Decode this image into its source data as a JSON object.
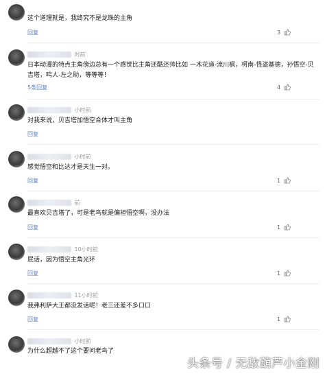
{
  "comments": [
    {
      "time": "",
      "text": "这个道理就是，我终究不是龙珠的主角",
      "reply_label": "回复",
      "replies_label": "",
      "likes": "3"
    },
    {
      "time": "时前",
      "text": "日本动漫的特点主角傍边总有一个感觉比主角还酷还帅比如 一木花道-流川枫，柯南-怪盗基德，孙悟空-贝吉塔，鸣人-左之助，等等等！",
      "reply_label": "",
      "replies_label": "5条回复",
      "likes": "4"
    },
    {
      "time": "小时前",
      "text": "对我来说，贝吉塔加悟空合体才叫主角",
      "reply_label": "回复",
      "replies_label": "",
      "likes": ""
    },
    {
      "time": "小时前",
      "text": "感觉悟空和比达才是天生一对。",
      "reply_label": "回复",
      "replies_label": "",
      "likes": "1"
    },
    {
      "time": "前",
      "text": "最喜欢贝吉塔了，可是老鸟就是偏袒悟空啊，没办法",
      "reply_label": "回复",
      "replies_label": "",
      "likes": "1"
    },
    {
      "time": "10小时前",
      "text": "屁话，因为悟空主角光环",
      "reply_label": "回复",
      "replies_label": "",
      "likes": "1"
    },
    {
      "time": "11小时前",
      "text": "我弗利萨大王都没发话呢！老三还差不多口口",
      "reply_label": "回复",
      "replies_label": "",
      "likes": "1"
    },
    {
      "time": "小时前",
      "text": "为什么超越不了这个要问老鸟了",
      "reply_label": "",
      "replies_label": "",
      "likes": ""
    }
  ],
  "watermark": "头条号 / 无敌葫芦小金刚",
  "icons": {
    "like": "thumbs-up-icon"
  },
  "colors": {
    "link": "#5b7fbf",
    "text": "#222222",
    "meta": "#999999"
  }
}
